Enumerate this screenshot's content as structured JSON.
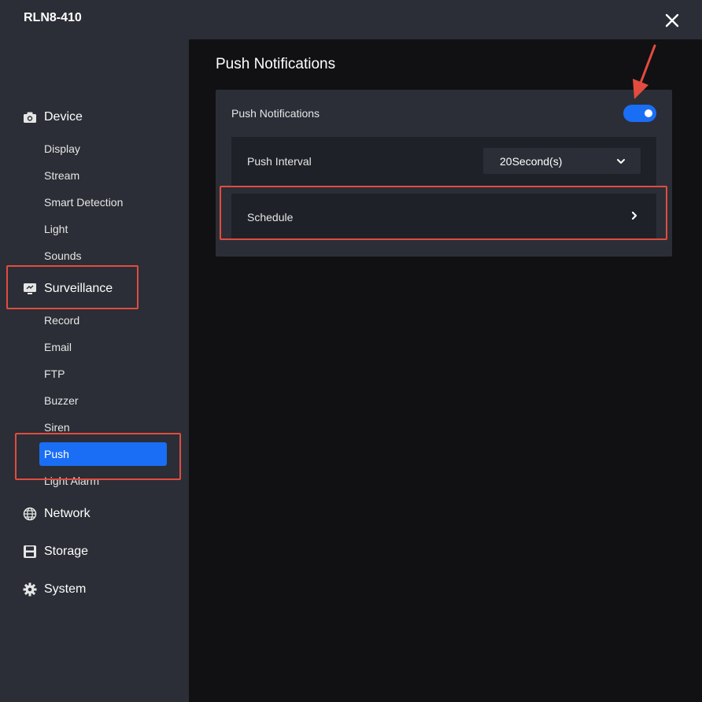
{
  "window": {
    "title": "RLN8-410"
  },
  "sidebar": {
    "sections": [
      {
        "label": "Device",
        "icon": "camera-icon"
      },
      {
        "label": "Surveillance",
        "icon": "monitor-icon"
      },
      {
        "label": "Network",
        "icon": "globe-icon"
      },
      {
        "label": "Storage",
        "icon": "save-icon"
      },
      {
        "label": "System",
        "icon": "gear-icon"
      }
    ],
    "device_items": [
      "Display",
      "Stream",
      "Smart Detection",
      "Light",
      "Sounds"
    ],
    "surveillance_items": [
      "Record",
      "Email",
      "FTP",
      "Buzzer",
      "Siren",
      "Push",
      "Light Alarm"
    ],
    "active_item": "Push"
  },
  "main": {
    "heading": "Push Notifications",
    "push_toggle": {
      "label": "Push Notifications",
      "enabled": true
    },
    "push_interval": {
      "label": "Push Interval",
      "value": "20Second(s)"
    },
    "schedule": {
      "label": "Schedule"
    }
  },
  "colors": {
    "accent": "#1a6ef5",
    "panel": "#2b2e36",
    "background": "#111113",
    "annotation": "#e24c3f"
  }
}
